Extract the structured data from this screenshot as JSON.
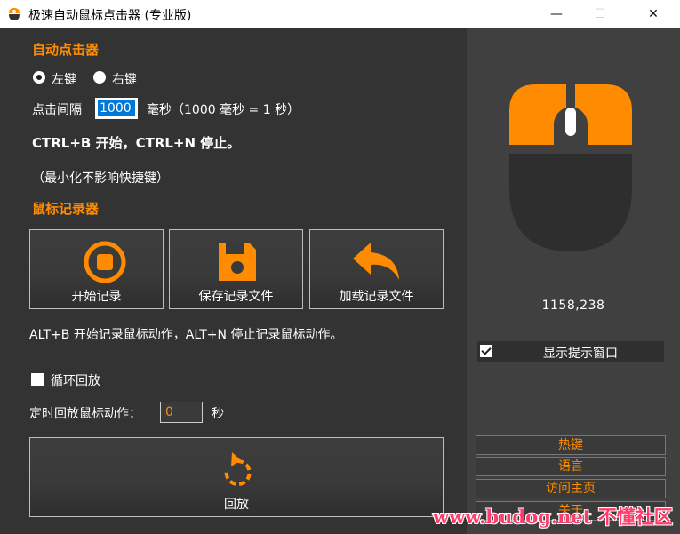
{
  "window": {
    "title": "极速自动鼠标点击器 (专业版)",
    "minimize_glyph": "—",
    "maximize_glyph": "☐",
    "close_glyph": "✕"
  },
  "clicker": {
    "section_title": "自动点击器",
    "left_label": "左键",
    "right_label": "右键",
    "selected": "左键",
    "interval_label": "点击间隔",
    "interval_value": "1000",
    "interval_unit": "毫秒（1000 毫秒 = 1 秒）",
    "hotkey_text": "CTRL+B 开始，CTRL+N 停止。",
    "minimize_note": "（最小化不影响快捷键）"
  },
  "recorder": {
    "section_title": "鼠标记录器",
    "buttons": [
      {
        "label": "开始记录",
        "icon": "record-icon"
      },
      {
        "label": "保存记录文件",
        "icon": "save-icon"
      },
      {
        "label": "加载记录文件",
        "icon": "load-icon"
      }
    ],
    "hotkey_text": "ALT+B 开始记录鼠标动作，ALT+N 停止记录鼠标动作。",
    "loop_label": "循环回放",
    "loop_checked": false,
    "timed_label": "定时回放鼠标动作：",
    "timed_value": "0",
    "timed_unit": "秒",
    "replay_label": "回放",
    "replay_icon": "replay-icon"
  },
  "sidebar": {
    "mouse_icon": "mouse-icon",
    "coordinates": "1158,238",
    "show_tip_label": "显示提示窗口",
    "show_tip_checked": true,
    "links": [
      "热键",
      "语言",
      "访问主页",
      "关于"
    ]
  },
  "watermark": "www.budog.net 不懂社区",
  "colors": {
    "accent": "#ff8c00",
    "panel_dark": "#333333",
    "panel_side": "#404040",
    "selection": "#0078d7",
    "watermark": "#ff3b6b"
  }
}
